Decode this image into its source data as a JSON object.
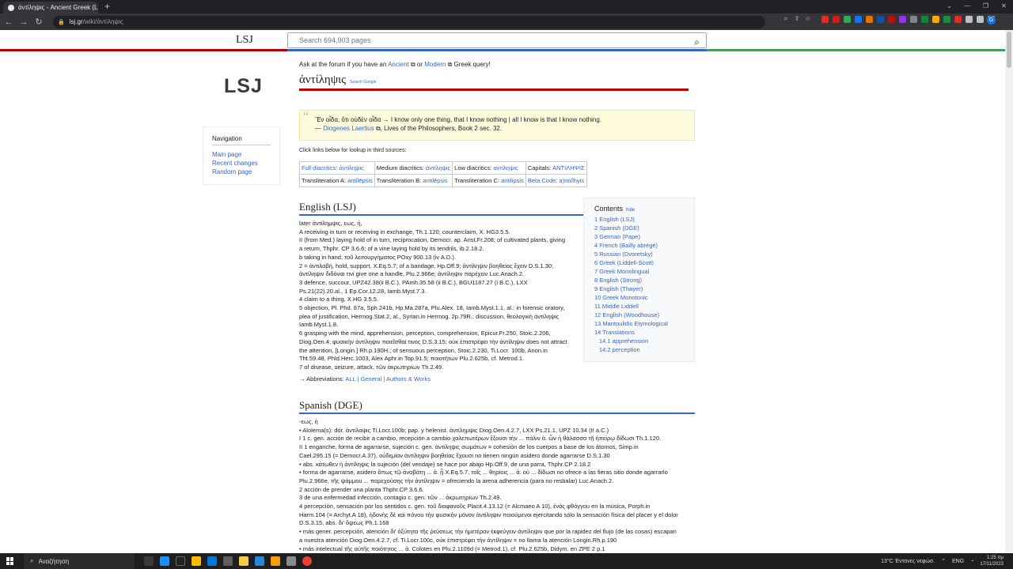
{
  "browser": {
    "tab_title": "ἀντίληψις - Ancient Greek (LSJ)",
    "url_host": "lsj.gr",
    "url_path": "/wiki/ἀντίληψις"
  },
  "header": {
    "brand": "LSJ",
    "search_placeholder": "Search 694,903 pages",
    "logo": "LSJ"
  },
  "colors": {
    "accent_left": "#b00000",
    "accent_mid": "#3366cc",
    "accent_right": "#4a9a5c"
  },
  "navigation": {
    "title": "Navigation",
    "items": [
      "Main page",
      "Recent changes",
      "Random page"
    ]
  },
  "notice": {
    "prefix": "Ask at the forum if you have an ",
    "ancient": "Ancient",
    "or": " or ",
    "modern": "Modern",
    "suffix": " Greek query!"
  },
  "lemma": {
    "word": "ἀντίληψις",
    "search_google": "Search Google"
  },
  "quote": {
    "line1": "Ἓν οἶδα, ὅτι οὐδὲν οἶδα → I know only one thing, that I know nothing | all I know is that I know nothing.",
    "line2_prefix": "— ",
    "author": "Diogenes Laertius",
    "line2_suffix": ", Lives of the Philosophers, Book 2 sec. 32."
  },
  "click_links": "Click links below for lookup in third sources:",
  "lookup": [
    [
      {
        "l": "Full diacritics: ",
        "v": "ἀντίληψις"
      },
      {
        "l": "Medium diacritics: ",
        "v": "ἀντίληψις"
      },
      {
        "l": "Low diacritics: ",
        "v": "αντίληψις"
      },
      {
        "l": "Capitals: ",
        "v": "ΑΝΤΙΛΗΨΙΣ"
      }
    ],
    [
      {
        "l": "Transliteration A: ",
        "v": "antílēpsis"
      },
      {
        "l": "Transliteration B: ",
        "v": "antilēpsis"
      },
      {
        "l": "Transliteration C: ",
        "v": "antilipsis"
      },
      {
        "l": "Beta Code: ",
        "v": "a)nti/lhyis"
      }
    ]
  ],
  "sections": {
    "english": "English (LSJ)",
    "spanish": "Spanish (DGE)"
  },
  "toc": {
    "title": "Contents",
    "hide": "hide",
    "items": [
      "1 English (LSJ)",
      "2 Spanish (DGE)",
      "3 German (Pape)",
      "4 French (Bailly abrégé)",
      "5 Russian (Dvoretsky)",
      "6 Greek (Liddell-Scott)",
      "7 Greek Monolingual",
      "8 English (Strong)",
      "9 English (Thayer)",
      "10 Greek Monotonic",
      "11 Middle Liddell",
      "12 English (Woodhouse)",
      "13 Mantoulidis Etymological",
      "14 Translations"
    ],
    "sub": [
      "14.1 apprehension",
      "14.2 perception"
    ]
  },
  "english_lines": [
    "later ἀντίλημψις, εως, ἡ,",
    "A  receiving in turn or receiving in exchange, Th.1.120; counterclaim, X. HG3.5.5.",
    "II  (from Med.) laying hold of in turn, reciprocation, Democr. ap. Arist.Fr.208; of cultivated plants, giving",
    "a return, Thphr. CP 3.6.6; of a vine laying hold by its tendrils, ib.2.18.2.",
    "b  taking in hand, τοῦ λειτουργήματος POxy 900.13 (iv A.D.).",
    "2  = ἀντιλαβή, hold, support, X.Eq.5.7; of a bandage, Hp.Off.9; ἀντίληψιν βοηθείας ἔχειν D.S.1.30;",
    "ἀντίληψιν διδόναι τινί give one a handle, Plu.2.966e; ἀντίληψιν παρέχειν Luc.Anach.2.",
    "3  defence, succour, UPZ42.38(ii B.C.), PAmh.35.58 (ii B.C.), BGU1187.27 (i B.C.), LXX",
    "Ps.21(22).20.al., 1 Ep.Cor.12.28, Iamb.Myst.7.3.",
    "4  claim to a thing, X.HG 3.5.5.",
    "5  objection, Pl. Phd. 87a, Sph.241b, Hp.Ma.287a, Plu.Alex. 18, Iamb.Myst.1.1, al.: in forensic oratory,",
    "plea of justification, Hermog.Stat.2, al., Syrian.in Hermog. 2p.79R.; discussion, θεολογικὴ ἀντίληψις",
    "Iamb.Myst.1.8.",
    "6  grasping with the mind, apprehension, perception, comprehension, Epicur.Fr.250, Stoic.2.206,",
    "Diog.Oen.4; φυσικὴν ἀντίληψιν ποιεῖσθαί τινος D.S.3.15; οὐκ ἐπιστρέφει τὴν ἀντίληψιν does not attract",
    "the attention, [Longin.] Rh.p.190H.; of sensuous perception, Stoic.2.230, Ti.Locr. 100b, Anon.in",
    "Tht.59.48, Phld.Herc.1003, Alex Aphr.in Top.91.5; ποιοτήτων Plu.2.625b, cf. Metrod.1.",
    "7  of disease, seizure, attack, τῶν ἀκρωτηρίων Th.2.49."
  ],
  "abbreviations": {
    "label": "→ Abbreviations: ",
    "links": "ALL | General | Authors & Works"
  },
  "spanish_lines": [
    "-εως, ἡ",
    "• Alolema(s): dór. ἀντίλαψις Ti.Locr.100b; pap. y helenist. ἀντίλημψις Diog.Oen.4.2.7, LXX Ps.21.1, UPZ 10.34 (II a.C.)",
    "I   1 c. gen. acción de recibir a cambio, recepción a cambio χαλεπωτέρων ἔξουσι τὴν ... πάλιν ἀ. ὧν ἡ θάλασσα τῇ ἠπείρῳ δίδωσι Th.1.120.",
    "II   1 enganche, forma de agarrarse, sujeción c. gen. ἀντίληψις σωμάτων = cohesión de los cuerpos a base de los átomos, Simp.in",
    "Cael.295.15 (= Democr.A 37), οὐδεμίαν ἀντίληψιν βοηθείας ἔχουσι no tienen ningún asidero donde agarrarse D.S.1.30",
    "• abs. κάτωθεν ἡ ἀντίληψις la sujeción (del vendaje) se hace por abajo Hp.Off.9, de una parra, Thphr.CP 2.18.2",
    "• forma de agarrarse, asidero ὅπως τῷ ἀναβάτῃ ... ἀ. ᾖ X.Eq.5.7, τοῖς ... θηρίοις ... ἀ. οὐ ... δίδωσι no ofrece a las fieras sitio donde agarrarlo",
    "Plu.2.966e, τῆς ψάμμου ... παρεχούσης τὴν ἀντίληψιν = ofreciendo la arena adherencia (para no resbalar) Luc.Anach.2.",
    "2  acción de prender una planta Thphr.CP 3.6.6.",
    "3  de una enfermedad infección, contagio c. gen. τῶν ... ἀκρωτηρίων Th.2.49.",
    "4  percepción, sensación por los sentidos c. gen. τοῦ διαφανοῦς Placit.4.13.12 (= Alcmaeo A 10), ἐνὸς φθόγγου en la música, Porph.in",
    "Harm.104 (= Archyt.A 18), ἡδονὴς δὲ καὶ πόνου τὴν φυσικὴν μόνον ἀντίληψιν ποιούμενοι ejercitando sólo la sensación física del placer y el dolor",
    "D.S.3.15, abs. δι' ὄψεως Ph.1.168",
    "• más gener. percepción, atención δι' ὀξύτητα τῆς ῥεύσεως τὴν ἡμετέραν ἐκφεύγειν ἀντίληψιν que por la rapidez del flujo (de las cosas) escapan",
    "a nuestra atención Diog.Oen.4.2.7, cf. Ti.Locr.100c, οὐκ ἐπιστρέφει τὴν ἀντίληψιν = no llama la atención Longin.Rh.p.190",
    "• más intelectual τῆς αὐτῆς ποιότητος ... ἀ. Colotes en Plu.2.1109d (= Metrod.1), cf. Plu.2.625b, Didym. en ZPE 2 p.1"
  ],
  "taskbar": {
    "search": "Αναζήτηση",
    "weather": "13°C  Έντονες νεφώσ.",
    "lang": "ENG",
    "time": "1:25 πμ",
    "date": "17/11/2023"
  }
}
